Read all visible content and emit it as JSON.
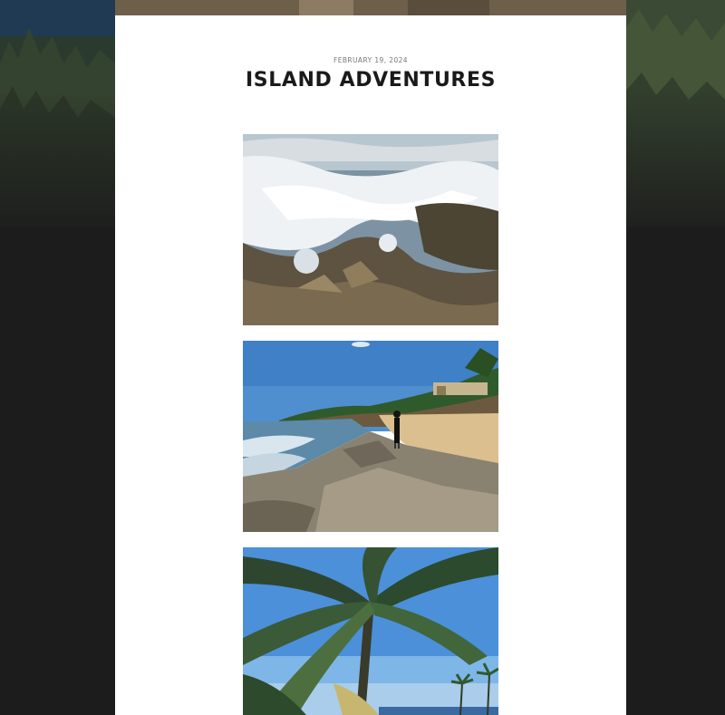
{
  "post": {
    "date": "FEBRUARY 19, 2024",
    "title": "ISLAND ADVENTURES"
  },
  "gallery": {
    "images": [
      {
        "subject": "ocean-waves-on-rocks"
      },
      {
        "subject": "person-on-rocky-beach"
      },
      {
        "subject": "palm-tree-and-sky"
      }
    ]
  },
  "colors": {
    "background": "#1c1c1c",
    "card": "#ffffff",
    "title": "#1a1a1a",
    "date": "#777777"
  }
}
